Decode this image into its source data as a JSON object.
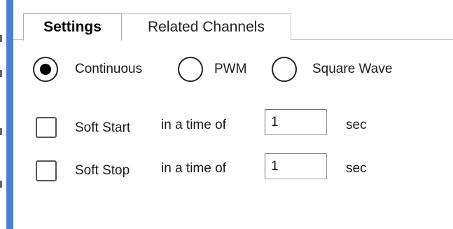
{
  "tabs": [
    {
      "label": "Settings",
      "active": true
    },
    {
      "label": "Related Channels",
      "active": false
    }
  ],
  "mode": {
    "options": [
      "Continuous",
      "PWM",
      "Square Wave"
    ],
    "selected": "Continuous"
  },
  "soft_start": {
    "label": "Soft Start",
    "checked": false,
    "time_prefix": "in a time of",
    "value": "1",
    "unit": "sec"
  },
  "soft_stop": {
    "label": "Soft Stop",
    "checked": false,
    "time_prefix": "in a time of",
    "value": "1",
    "unit": "sec"
  },
  "colors": {
    "left_bar": "#4d7fd6"
  }
}
